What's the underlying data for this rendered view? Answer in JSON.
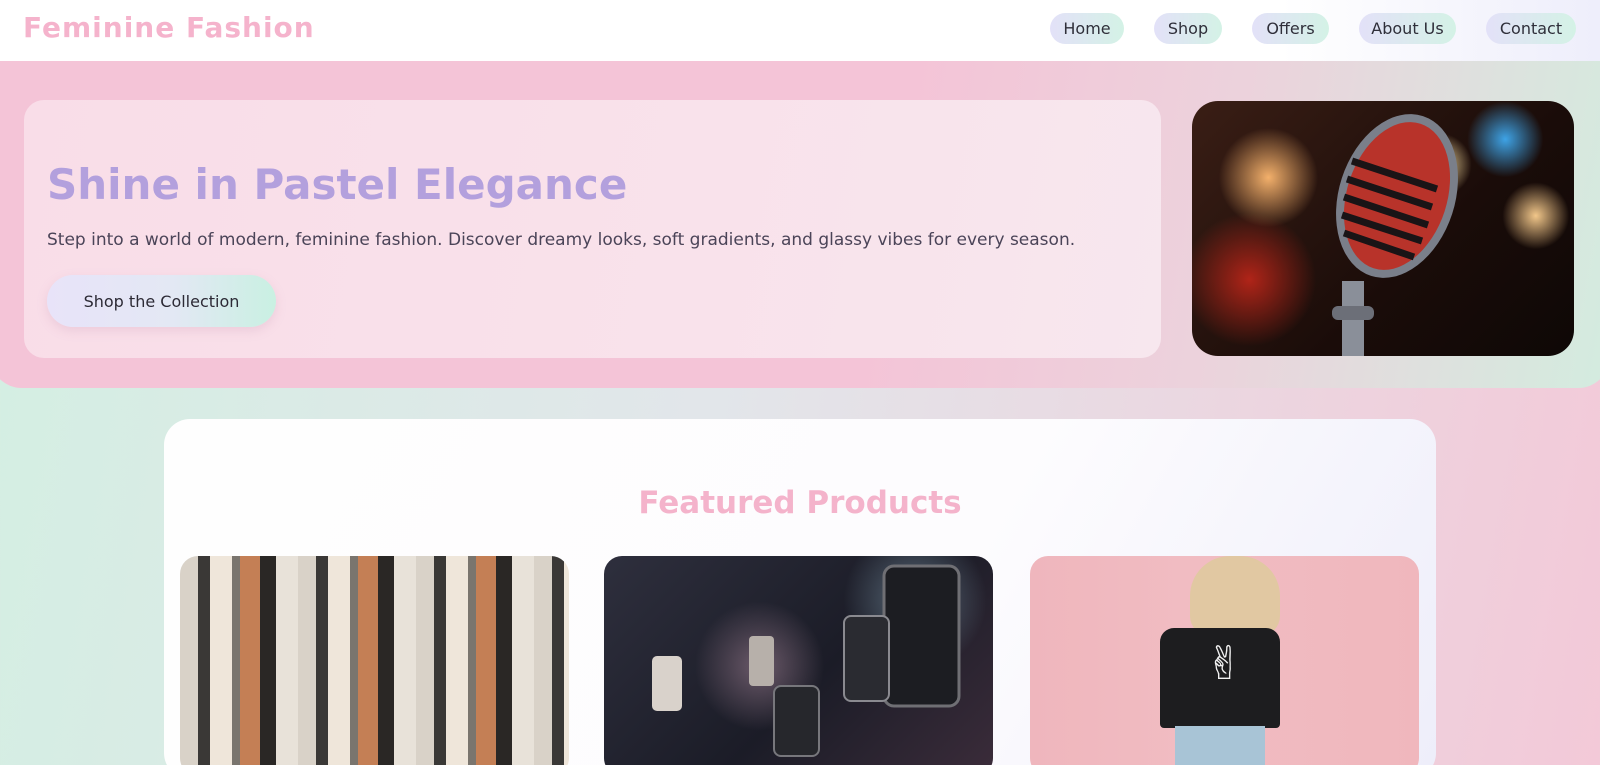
{
  "header": {
    "brand": "Feminine Fashion",
    "nav": [
      "Home",
      "Shop",
      "Offers",
      "About Us",
      "Contact"
    ]
  },
  "hero": {
    "title": "Shine in Pastel Elegance",
    "subtitle": "Step into a world of modern, feminine fashion. Discover dreamy looks, soft gradients, and glassy vibes for every season.",
    "cta": "Shop the Collection",
    "image_icon": "microphone-image"
  },
  "featured": {
    "title": "Featured Products",
    "products": [
      {
        "icon": "clothing-rack-image"
      },
      {
        "icon": "concert-phones-image"
      },
      {
        "icon": "woman-tshirt-image"
      }
    ]
  },
  "colors": {
    "brand": "#f5b3cc",
    "hero_title": "#b3a0dd",
    "featured_title": "#f4b3cb"
  }
}
